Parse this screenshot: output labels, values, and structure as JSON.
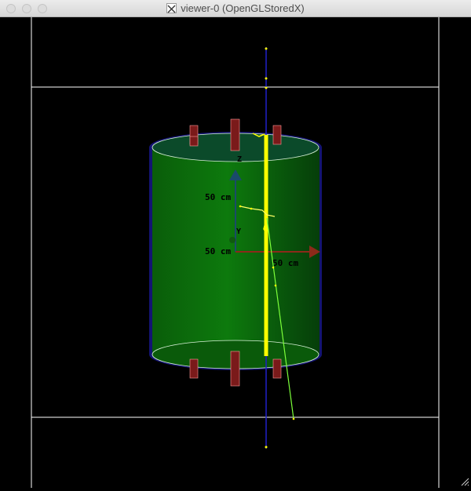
{
  "window": {
    "title": "viewer-0 (OpenGLStoredX)"
  },
  "scene": {
    "axis_labels": {
      "z_length": "50 cm",
      "y_length": "50 cm",
      "x_length": "50 cm",
      "z_name": "Z",
      "y_name": "Y"
    },
    "colors": {
      "background": "#000000",
      "cylinder_fill": "#0a6b0a",
      "cylinder_outline": "#141473",
      "beam_line": "#2020c8",
      "track_primary": "#ffff00",
      "track_secondary": "#7cff3a",
      "x_axis": "#8b2a1a",
      "z_axis": "#1a4a6b",
      "frame_lines": "#ffffff",
      "pmt": "#8b1a1a"
    }
  }
}
